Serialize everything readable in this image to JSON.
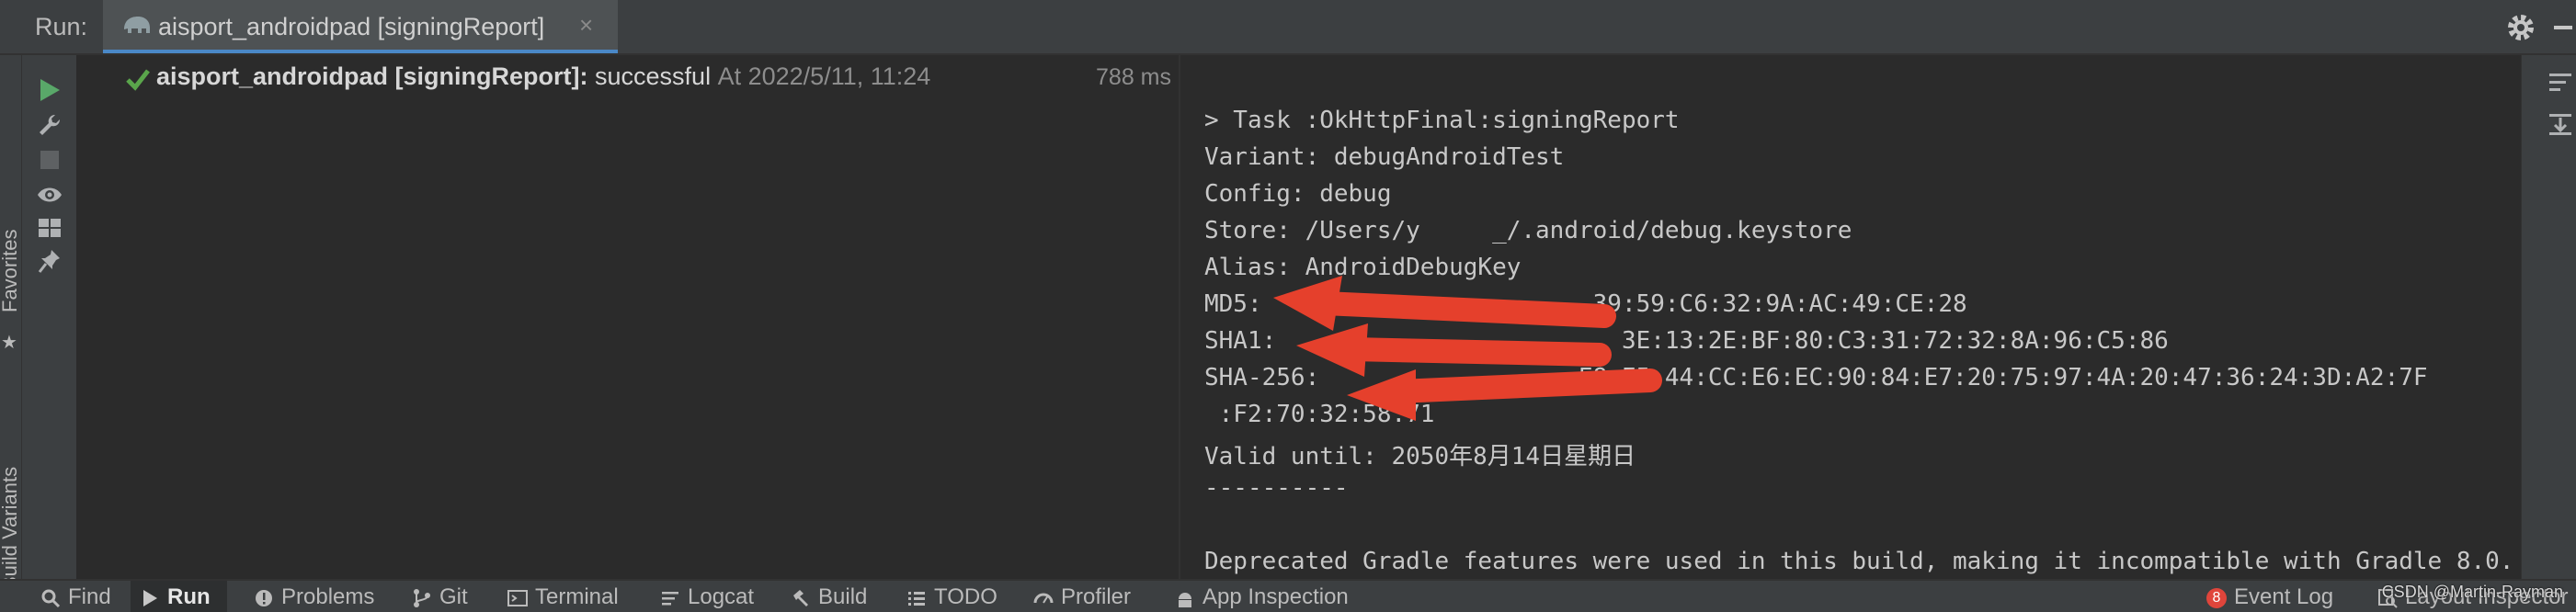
{
  "run_bar": {
    "label": "Run:",
    "tab_title": "aisport_androidpad [signingReport]",
    "tab_close": "×"
  },
  "side_labels": {
    "favorites": "Favorites",
    "build_variants": "Build Variants"
  },
  "build_tree": {
    "title": "aisport_androidpad [signingReport]:",
    "status": "successful",
    "timestamp": "At 2022/5/11, 11:24",
    "duration": "788 ms"
  },
  "console": {
    "lines": [
      "----------",
      "",
      "> Task :OkHttpFinal:signingReport",
      "Variant: debugAndroidTest",
      "Config: debug",
      "Store: /Users/y     _/.android/debug.keystore",
      "Alias: AndroidDebugKey",
      "MD5:                       39:59:C6:32:9A:AC:49:CE:28",
      "SHA1:                        3E:13:2E:BF:80:C3:31:72:32:8A:96:C5:86",
      "SHA-256:                  E8:E5:44:CC:E6:EC:90:84:E7:20:75:97:4A:20:47:36:24:3D:A2:7F",
      " :F2:70:32:58:71",
      "Valid until: 2050年8月14日星期日",
      "----------",
      "",
      "Deprecated Gradle features were used in this build, making it incompatible with Gradle 8.0."
    ]
  },
  "bottom_tabs": {
    "find": "Find",
    "run": "Run",
    "problems": "Problems",
    "git": "Git",
    "terminal": "Terminal",
    "logcat": "Logcat",
    "build": "Build",
    "todo": "TODO",
    "profiler": "Profiler",
    "app_inspection": "App Inspection",
    "event_log": "Event Log",
    "event_log_count": "8",
    "layout_inspector": "Layout Inspector"
  },
  "watermark": "CSDN @Martin-Rayman",
  "colors": {
    "success_check": "#5aa54b",
    "run_icon": "#59a869",
    "arrow_red": "#e5402c",
    "selected_tab_underline": "#4a88c7"
  }
}
